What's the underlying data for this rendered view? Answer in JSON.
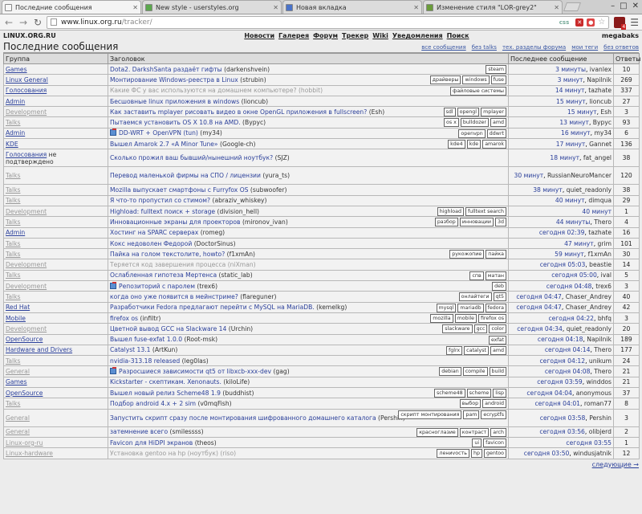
{
  "browser": {
    "tabs": [
      {
        "label": "Последние сообщения",
        "color": "#f7f7f7",
        "active": true
      },
      {
        "label": "New style - userstyles.org",
        "color": "#5ba84d",
        "active": false
      },
      {
        "label": "Новая вкладка",
        "color": "#4a73c9",
        "active": false
      },
      {
        "label": "Изменение стиля \"LOR-grey2\"",
        "color": "#6a9c3a",
        "active": false
      }
    ],
    "url_main": "www.linux.org.ru",
    "url_path": "/tracker/",
    "css_badge": "css",
    "ext_badge_count": "4"
  },
  "site": {
    "logo": "LINUX.ORG.RU",
    "nav": [
      "Новости",
      "Галерея",
      "Форум",
      "Трекер",
      "Wiki",
      "Уведомления",
      "Поиск"
    ],
    "user": "megabaks",
    "page_title": "Последние сообщения",
    "filters": [
      "все сообщения",
      "без talks",
      "тех. разделы форума",
      "мои теги",
      "без ответов"
    ],
    "columns": {
      "group": "Группа",
      "title": "Заголовок",
      "last": "Последнее сообщение",
      "replies": "Ответы"
    },
    "next_link": "следующие →"
  },
  "rows": [
    {
      "group": "Games",
      "title": "Dota2. DarkshSanta раздаёт гифты",
      "author": "(darkenshvein)",
      "tags": [
        "steam"
      ],
      "time": "3 минуты",
      "by": "ivanlex",
      "count": "10"
    },
    {
      "group": "Linux General",
      "title": "Монтирование Windows-реестра в Linux",
      "author": "(strubin)",
      "tags": [
        "драйверы",
        "windows",
        "fuse"
      ],
      "time": "3 минут",
      "by": "Napilnik",
      "count": "269"
    },
    {
      "group": "Голосования",
      "title": "Какие ФС у вас используются на домашнем компьютере?",
      "author": "(hobbit)",
      "tags": [
        "файловые системы"
      ],
      "time": "14 минут",
      "by": "tazhate",
      "count": "337",
      "title_muted": true
    },
    {
      "group": "Admin",
      "title": "Бесшовные linux приложения в windows",
      "author": "(lioncub)",
      "tags": [],
      "time": "15 минут",
      "by": "lioncub",
      "count": "27"
    },
    {
      "group": "Development",
      "title": "Как заставить mplayer рисовать видео в окне OpenGL приложения в fullscreen?",
      "author": "(Esh)",
      "tags": [
        "sdl",
        "opengl",
        "mplayer"
      ],
      "time": "15 минут",
      "by": "Esh",
      "count": "3",
      "muted": true
    },
    {
      "group": "Talks",
      "title": "Пытаемся установить OS X 10.8 на AMD.",
      "author": "(Вурус)",
      "tags": [
        "os x",
        "bulldozer",
        "amd"
      ],
      "time": "13 минут",
      "by": "Вурус",
      "count": "93",
      "muted": true
    },
    {
      "group": "Admin",
      "title": "DD-WRT + OpenVPN (tun)",
      "author": "(my34)",
      "tags": [
        "openvpn",
        "ddwrt"
      ],
      "time": "16 минут",
      "by": "my34",
      "count": "6",
      "sticky": true
    },
    {
      "group": "KDE",
      "title": "Вышел Amarok 2.7 «A Minor Tune»",
      "author": "(Google-ch)",
      "tags": [
        "kde4",
        "kde",
        "amarok"
      ],
      "time": "17 минут",
      "by": "Gannet",
      "count": "136"
    },
    {
      "group": "Голосования",
      "group_extra": " не подтверждено",
      "title": "Сколько прожил ваш бывший/нынешний ноутбук?",
      "author": "(SJZ)",
      "tags": [],
      "time": "18 минут",
      "by": "fat_angel",
      "count": "38",
      "tall": true
    },
    {
      "group": "Talks",
      "title": "Перевод маленькой фирмы на СПО / лицензии",
      "author": "(yura_ts)",
      "tags": [],
      "time": "30 минут",
      "by": "RussianNeuroMancer",
      "count": "120",
      "muted": true,
      "tall": true
    },
    {
      "group": "Talks",
      "title": "Mozilla выпускает смартфоны с Furryfox OS",
      "author": "(subwoofer)",
      "tags": [],
      "time": "38 минут",
      "by": "quiet_readonly",
      "count": "38",
      "muted": true
    },
    {
      "group": "Talks",
      "title": "Я что-то пропустил со стимом?",
      "author": "(abraziv_whiskey)",
      "tags": [],
      "time": "40 минут",
      "by": "dimqua",
      "count": "29",
      "muted": true
    },
    {
      "group": "Development",
      "title": "Highload: fulltext поиск + storage",
      "author": "(division_hell)",
      "tags": [
        "highload",
        "fulltext search"
      ],
      "time": "40 минут",
      "by": "",
      "count": "1",
      "muted": true
    },
    {
      "group": "Talks",
      "title": "Инновационные экраны для проекторов",
      "author": "(mironov_ivan)",
      "tags": [
        "разбор",
        "инновации",
        "3d"
      ],
      "time": "44 минуты",
      "by": "Thero",
      "count": "4",
      "muted": true
    },
    {
      "group": "Admin",
      "title": "Хостинг на SPARC серверах",
      "author": "(romeg)",
      "tags": [],
      "time": "сегодня 02:39",
      "by": "tazhate",
      "count": "16"
    },
    {
      "group": "Talks",
      "title": "Кокс недоволен Федорой",
      "author": "(DoctorSinus)",
      "tags": [],
      "time": "47 минут",
      "by": "grim",
      "count": "101",
      "muted": true
    },
    {
      "group": "Talks",
      "title": "Пайка на голом текстолите, howto?",
      "author": "(f1xmAn)",
      "tags": [
        "рукожопие",
        "пайка"
      ],
      "time": "59 минут",
      "by": "f1xmAn",
      "count": "30",
      "muted": true
    },
    {
      "group": "Development",
      "title": "Теряется код завершения процесса",
      "author": "(niXman)",
      "tags": [],
      "time": "сегодня 05:03",
      "by": "beastie",
      "count": "14",
      "muted": true,
      "title_muted": true
    },
    {
      "group": "Talks",
      "title": "Ослабленная гипотеза Мертенса",
      "author": "(static_lab)",
      "tags": [
        "спв",
        "матан"
      ],
      "time": "сегодня 05:00",
      "by": "ival",
      "count": "5",
      "muted": true
    },
    {
      "group": "Development",
      "title": "Репозиторий с паролем",
      "author": "(trex6)",
      "tags": [
        "deb"
      ],
      "time": "сегодня 04:48",
      "by": "trex6",
      "count": "3",
      "muted": true,
      "sticky": true
    },
    {
      "group": "Talks",
      "title": "когда оно уже появится в мейнстриме?",
      "author": "(flareguner)",
      "tags": [
        "онлайтеги",
        "qt5"
      ],
      "time": "сегодня 04:47",
      "by": "Chaser_Andrey",
      "count": "40",
      "muted": true
    },
    {
      "group": "Red Hat",
      "title": "Разработчики Fedora предлагают перейти с MySQL на MariaDB.",
      "author": "(kemelkg)",
      "tags": [
        "mysql",
        "mariadb",
        "fedora"
      ],
      "time": "сегодня 04:47",
      "by": "Chaser_Andrey",
      "count": "42"
    },
    {
      "group": "Mobile",
      "title": "firefox os",
      "author": "(infiltr)",
      "tags": [
        "mozilla",
        "mobile",
        "firefox os"
      ],
      "time": "сегодня 04:22",
      "by": "bhfq",
      "count": "3"
    },
    {
      "group": "Development",
      "title": "Цветной вывод GCC на Slackware 14",
      "author": "(Urchin)",
      "tags": [
        "slackware",
        "gcc",
        "color"
      ],
      "time": "сегодня 04:34",
      "by": "quiet_readonly",
      "count": "20",
      "muted": true
    },
    {
      "group": "OpenSource",
      "title": "Вышел fuse-exfat 1.0.0",
      "author": "(Root-msk)",
      "tags": [
        "exfat"
      ],
      "time": "сегодня 04:18",
      "by": "Napilnik",
      "count": "189"
    },
    {
      "group": "Hardware and Drivers",
      "title": "Catalyst 13.1",
      "author": "(ArtKun)",
      "tags": [
        "fglrx",
        "catalyst",
        "amd"
      ],
      "time": "сегодня 04:14",
      "by": "Thero",
      "count": "177"
    },
    {
      "group": "Talks",
      "title": "nvidia-313.18 released",
      "author": "(leg0las)",
      "tags": [],
      "time": "сегодня 04:12",
      "by": "unikum",
      "count": "24",
      "muted": true
    },
    {
      "group": "General",
      "title": "Разросшиеся зависимости qt5 от libxcb-xxx-dev",
      "author": "(gag)",
      "tags": [
        "debian",
        "compile",
        "build"
      ],
      "time": "сегодня 04:08",
      "by": "Thero",
      "count": "21",
      "muted": true,
      "sticky": true
    },
    {
      "group": "Games",
      "title": "Kickstarter - скептикам. Xenonauts.",
      "author": "(kiloLife)",
      "tags": [],
      "time": "сегодня 03:59",
      "by": "winddos",
      "count": "21"
    },
    {
      "group": "OpenSource",
      "title": "Вышел новый релиз Scheme48 1.9",
      "author": "(buddhist)",
      "tags": [
        "scheme48",
        "scheme",
        "lisp"
      ],
      "time": "сегодня 04:04",
      "by": "anonymous",
      "count": "37"
    },
    {
      "group": "Talks",
      "title": "Подбор android 4.x + 2 sim",
      "author": "(v0mqFish)",
      "tags": [
        "выбор",
        "android"
      ],
      "time": "сегодня 04:01",
      "by": "roman77",
      "count": "8",
      "muted": true
    },
    {
      "group": "General",
      "title": "Запустить скрипт сразу после монтирования шифрованного домашнего каталога",
      "author": "(Pershin)",
      "tags": [
        "скрипт монтирования",
        "pam",
        "ecryptfs"
      ],
      "time": "сегодня 03:58",
      "by": "Pershin",
      "count": "3",
      "muted": true,
      "tall": true
    },
    {
      "group": "General",
      "title": "затемнение всего",
      "author": "(smilessss)",
      "tags": [
        "красноглазие",
        "контраст",
        "arch"
      ],
      "time": "сегодня 03:56",
      "by": "olibjerd",
      "count": "2",
      "muted": true
    },
    {
      "group": "Linux-org-ru",
      "title": "Favicon для HiDPI экранов",
      "author": "(theos)",
      "tags": [
        "ui",
        "favicon"
      ],
      "time": "сегодня 03:55",
      "by": "",
      "count": "1",
      "muted": true
    },
    {
      "group": "Linux-hardware",
      "title": "Установка gentoo на hp (ноутбук)",
      "author": "(riso)",
      "tags": [
        "лениvость",
        "hp",
        "gentoo"
      ],
      "time": "сегодня 03:50",
      "by": "windusjatnik",
      "count": "12",
      "muted": true,
      "title_muted": true
    }
  ]
}
